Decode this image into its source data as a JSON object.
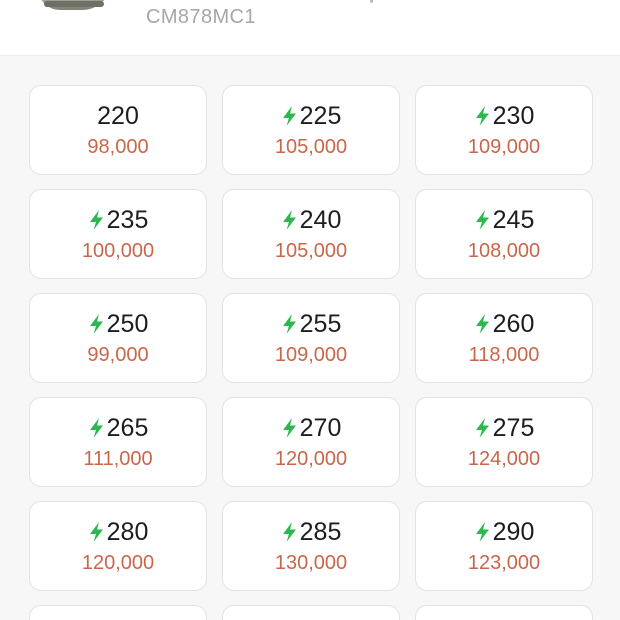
{
  "product": {
    "model_code": "CM878MC1"
  },
  "colors": {
    "bolt": "#2db84d",
    "price": "#c8674a",
    "size": "#1d1d1d"
  },
  "sizes": [
    {
      "size": "220",
      "price": "98,000",
      "fast": false
    },
    {
      "size": "225",
      "price": "105,000",
      "fast": true
    },
    {
      "size": "230",
      "price": "109,000",
      "fast": true
    },
    {
      "size": "235",
      "price": "100,000",
      "fast": true
    },
    {
      "size": "240",
      "price": "105,000",
      "fast": true
    },
    {
      "size": "245",
      "price": "108,000",
      "fast": true
    },
    {
      "size": "250",
      "price": "99,000",
      "fast": true
    },
    {
      "size": "255",
      "price": "109,000",
      "fast": true
    },
    {
      "size": "260",
      "price": "118,000",
      "fast": true
    },
    {
      "size": "265",
      "price": "111,000",
      "fast": true
    },
    {
      "size": "270",
      "price": "120,000",
      "fast": true
    },
    {
      "size": "275",
      "price": "124,000",
      "fast": true
    },
    {
      "size": "280",
      "price": "120,000",
      "fast": true
    },
    {
      "size": "285",
      "price": "130,000",
      "fast": true
    },
    {
      "size": "290",
      "price": "123,000",
      "fast": true
    }
  ],
  "partial_row_count": 3,
  "icons": {
    "fast_delivery": "lightning-bolt-icon",
    "product_image": "sneaker-thumbnail"
  }
}
